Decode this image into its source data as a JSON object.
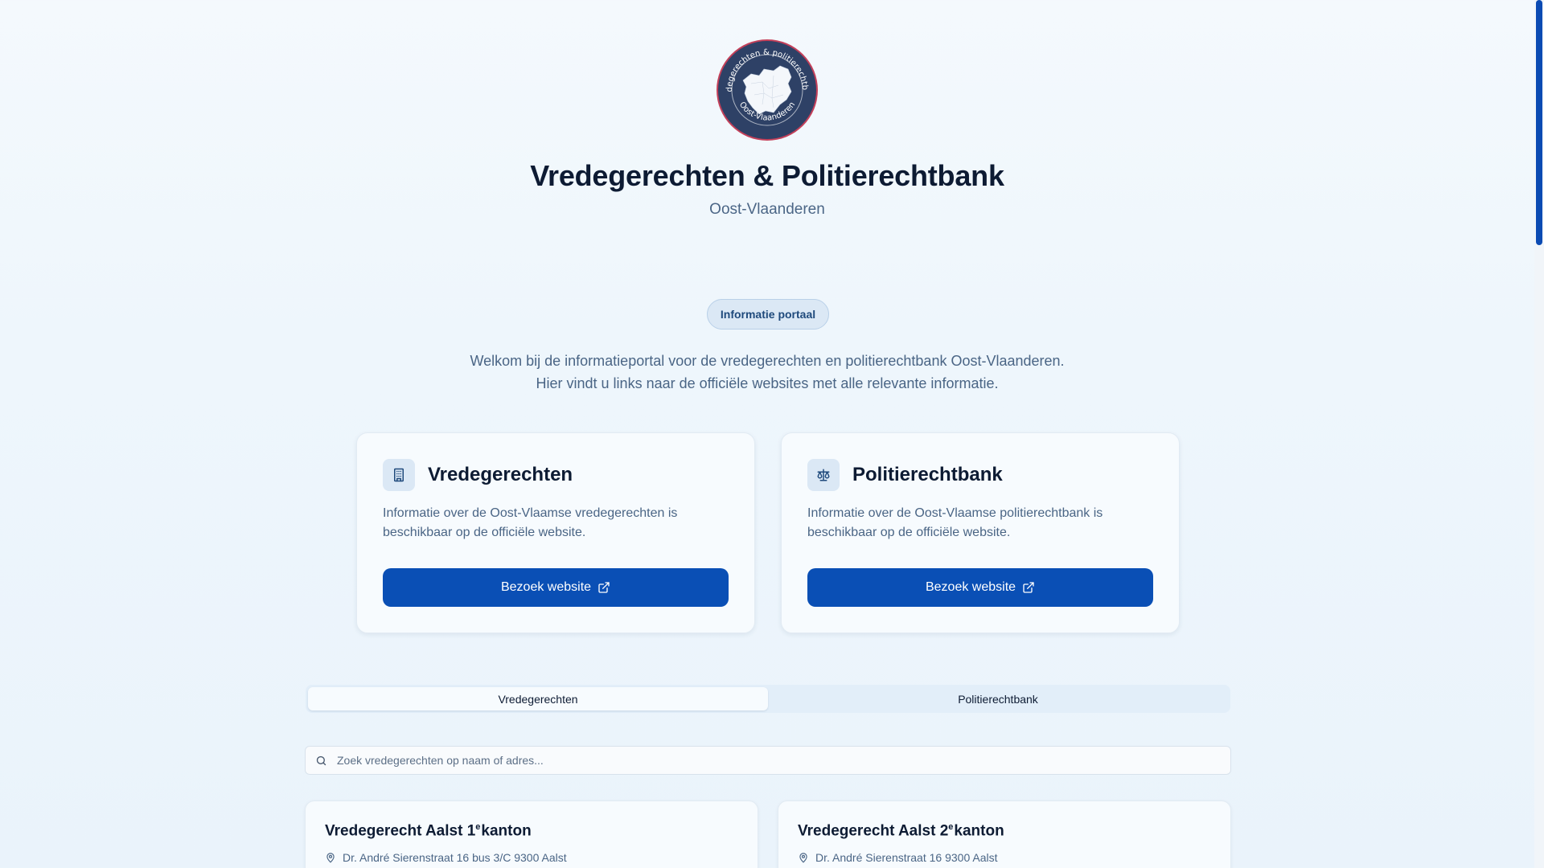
{
  "header": {
    "logo_text_top": "vredegerechten & politierechtbank",
    "logo_text_bottom": "Oost-Vlaanderen",
    "title": "Vredegerechten & Politierechtbank",
    "subtitle": "Oost-Vlaanderen"
  },
  "badge": "Informatie portaal",
  "intro": {
    "line1": "Welkom bij de informatieportal voor de vredegerechten en politierechtbank Oost-Vlaanderen.",
    "line2": "Hier vindt u links naar de officiële websites met alle relevante informatie."
  },
  "cards": [
    {
      "title": "Vredegerechten",
      "description": "Informatie over de Oost-Vlaamse vredegerechten is beschikbaar op de officiële website.",
      "button": "Bezoek website",
      "icon": "building-icon"
    },
    {
      "title": "Politierechtbank",
      "description": "Informatie over de Oost-Vlaamse politierechtbank is beschikbaar op de officiële website.",
      "button": "Bezoek website",
      "icon": "scales-icon"
    }
  ],
  "tabs": [
    {
      "label": "Vredegerechten",
      "active": true
    },
    {
      "label": "Politierechtbank",
      "active": false
    }
  ],
  "search": {
    "placeholder": "Zoek vredegerechten op naam of adres..."
  },
  "courts": [
    {
      "name_prefix": "Vredegerecht Aalst 1",
      "ordinal": "e",
      "name_suffix": "kanton",
      "address": "Dr. André Sierenstraat 16 bus 3/C 9300 Aalst"
    },
    {
      "name_prefix": "Vredegerecht Aalst 2",
      "ordinal": "e",
      "name_suffix": "kanton",
      "address": "Dr. André Sierenstraat 16 9300 Aalst"
    }
  ],
  "colors": {
    "primary": "#0a4fb5",
    "heading": "#0d1b33",
    "muted": "#4a6585",
    "badge_bg": "#dbe8f5",
    "logo_ring": "#c4405a",
    "logo_bg": "#2e4166"
  }
}
